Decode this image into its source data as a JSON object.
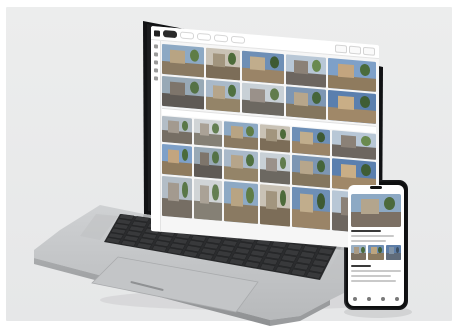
{
  "scene": {
    "description_colors": {
      "backdrop": "#e9eaea",
      "laptop_body": "#c7c9cb",
      "keyboard": "#262728",
      "bezel": "#121314",
      "phone_frame": "#1b1c1e"
    }
  },
  "laptop_app": {
    "toolbar_tabs": [
      "",
      "",
      "",
      "",
      ""
    ],
    "active_tab_index": 0,
    "sections": [
      "",
      ""
    ],
    "camera_scenes": [
      {
        "sky": "#8da9c4",
        "ground": "#8a7a62",
        "wall": "#b8a483",
        "tree": "#5f7d46"
      },
      {
        "sky": "#c9c2b5",
        "ground": "#7c6d58",
        "wall": "#a2957e",
        "tree": "#4d6b3a"
      },
      {
        "sky": "#6e8fb6",
        "ground": "#9a8467",
        "wall": "#c1ad8c",
        "tree": "#3e5a33"
      },
      {
        "sky": "#b8c7d6",
        "ground": "#6d6660",
        "wall": "#8b8177",
        "tree": "#6a8a4f"
      },
      {
        "sky": "#7ea0c8",
        "ground": "#8f7b5e",
        "wall": "#c3a57f",
        "tree": "#4a6b3c"
      },
      {
        "sky": "#98a9b6",
        "ground": "#5f5a55",
        "wall": "#7e756b",
        "tree": "#557245"
      },
      {
        "sky": "#a9b9c9",
        "ground": "#948468",
        "wall": "#b6a58a",
        "tree": "#4f7040"
      },
      {
        "sky": "#c8d0d6",
        "ground": "#6c6861",
        "wall": "#9a918a",
        "tree": "#617c4c"
      },
      {
        "sky": "#7d96b3",
        "ground": "#84765e",
        "wall": "#b7a68b",
        "tree": "#45653a"
      },
      {
        "sky": "#5a7fae",
        "ground": "#a08868",
        "wall": "#c9ae86",
        "tree": "#3f5d35"
      },
      {
        "sky": "#b3bdc6",
        "ground": "#766e64",
        "wall": "#a39a8f",
        "tree": "#5a7748"
      },
      {
        "sky": "#d0d4d6",
        "ground": "#858075",
        "wall": "#aaa296",
        "tree": "#647f52"
      }
    ],
    "section_one_layout": "mosaic",
    "section_two_layout": "strip"
  },
  "phone_app": {
    "status_time": "",
    "main_camera_scene": {
      "sky": "#8da9c4",
      "ground": "#7c7064",
      "wall": "#b3a58d",
      "tree": "#4c6a3d"
    },
    "thumbnails": [
      {
        "sky": "#9bb0c4",
        "ground": "#7b6f60",
        "wall": "#a99a84",
        "tree": "#4a6a3c"
      },
      {
        "sky": "#6f8fb4",
        "ground": "#8a7a60",
        "wall": "#bca57f",
        "tree": "#3f5d35"
      },
      {
        "sky": "#5d7ea8",
        "ground": "#5f6b7a",
        "wall": "#8093a7",
        "tree": "#3d4f63"
      }
    ]
  }
}
